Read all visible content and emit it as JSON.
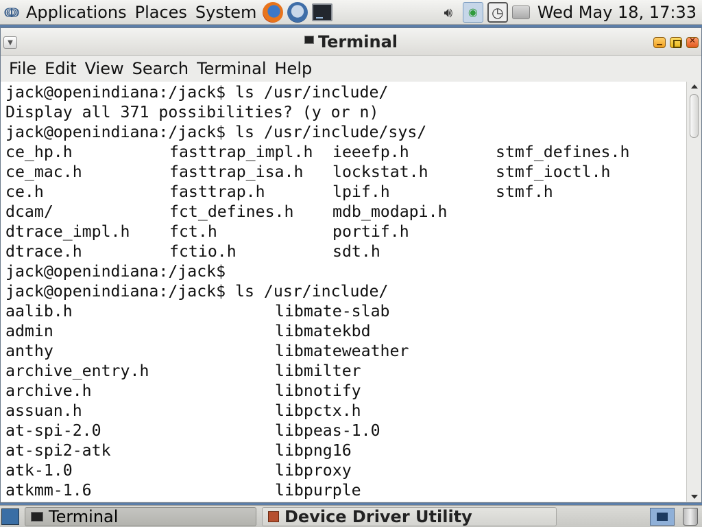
{
  "top_panel": {
    "menus": [
      "Applications",
      "Places",
      "System"
    ],
    "clock": "Wed May 18, 17:33"
  },
  "window": {
    "title": "Terminal",
    "menu": [
      "File",
      "Edit",
      "View",
      "Search",
      "Terminal",
      "Help"
    ]
  },
  "terminal": {
    "lines": [
      "jack@openindiana:/jack$ ls /usr/include/",
      "Display all 371 possibilities? (y or n)",
      "jack@openindiana:/jack$ ls /usr/include/sys/"
    ],
    "sys_listing": [
      [
        "ce_hp.h",
        "fasttrap_impl.h",
        "ieeefp.h",
        "stmf_defines.h"
      ],
      [
        "ce_mac.h",
        "fasttrap_isa.h",
        "lockstat.h",
        "stmf_ioctl.h"
      ],
      [
        "ce.h",
        "fasttrap.h",
        "lpif.h",
        "stmf.h"
      ],
      [
        "dcam/",
        "fct_defines.h",
        "mdb_modapi.h",
        ""
      ],
      [
        "dtrace_impl.h",
        "fct.h",
        "portif.h",
        ""
      ],
      [
        "dtrace.h",
        "fctio.h",
        "sdt.h",
        ""
      ]
    ],
    "lines_after": [
      "jack@openindiana:/jack$",
      "jack@openindiana:/jack$ ls /usr/include/"
    ],
    "include_listing": [
      [
        "aalib.h",
        "libmate-slab"
      ],
      [
        "admin",
        "libmatekbd"
      ],
      [
        "anthy",
        "libmateweather"
      ],
      [
        "archive_entry.h",
        "libmilter"
      ],
      [
        "archive.h",
        "libnotify"
      ],
      [
        "assuan.h",
        "libpctx.h"
      ],
      [
        "at-spi-2.0",
        "libpeas-1.0"
      ],
      [
        "at-spi2-atk",
        "libpng16"
      ],
      [
        "atk-1.0",
        "libproxy"
      ],
      [
        "atkmm-1.6",
        "libpurple"
      ]
    ]
  },
  "taskbar": {
    "tasks": [
      "Terminal",
      "Device Driver Utility"
    ]
  }
}
